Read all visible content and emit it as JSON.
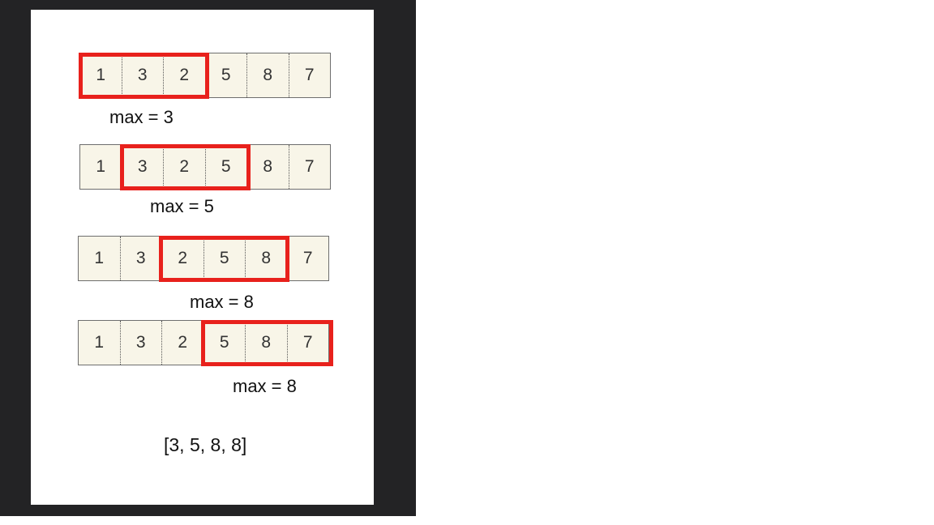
{
  "rows": [
    {
      "cells": [
        "1",
        "3",
        "2",
        "5",
        "8",
        "7"
      ],
      "label": "max = 3"
    },
    {
      "cells": [
        "1",
        "3",
        "2",
        "5",
        "8",
        "7"
      ],
      "label": "max = 5"
    },
    {
      "cells": [
        "1",
        "3",
        "2",
        "5",
        "8",
        "7"
      ],
      "label": "max = 8"
    },
    {
      "cells": [
        "1",
        "3",
        "2",
        "5",
        "8",
        "7"
      ],
      "label": "max = 8"
    }
  ],
  "result": "[3, 5, 8, 8]",
  "colors": {
    "window": "#e8211c",
    "cell_bg": "#f8f5e8",
    "frame": "#232325"
  }
}
